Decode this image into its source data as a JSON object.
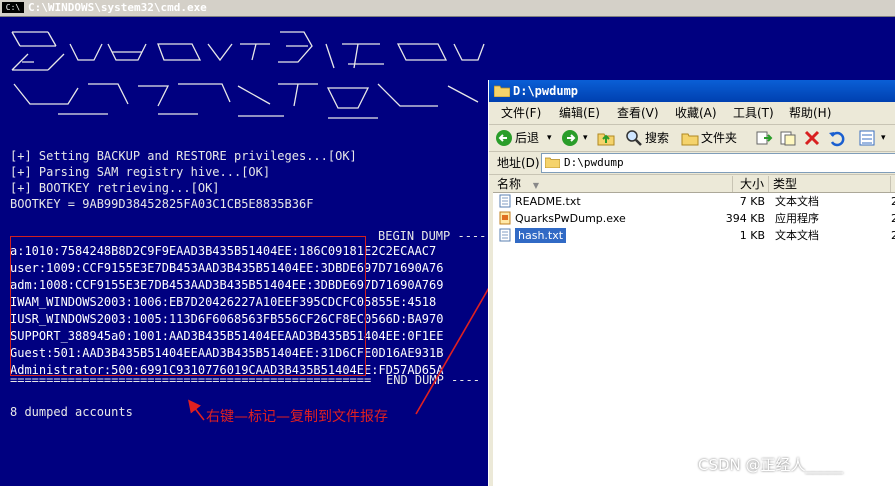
{
  "cmd": {
    "title": "C:\\WINDOWS\\system32\\cmd.exe",
    "title_icon": "C:\\",
    "status_lines": [
      "[+] Setting BACKUP and RESTORE privileges...[OK]",
      "[+] Parsing SAM registry hive...[OK]",
      "[+] BOOTKEY retrieving...[OK]",
      "BOOTKEY = 9AB99D38452825FA03C1CB5E8835B36F"
    ],
    "begin_dump": "BEGIN DUMP ----",
    "dump_lines": [
      "a:1010:7584248B8D2C9F9EAAD3B435B51404EE:186C09181E2C2ECAAC7",
      "user:1009:CCF9155E3E7DB453AAD3B435B51404EE:3DBDE697D71690A76",
      "adm:1008:CCF9155E3E7DB453AAD3B435B51404EE:3DBDE697D71690A769",
      "IWAM_WINDOWS2003:1006:EB7D20426227A10EEF395CDCFC05855E:4518",
      "IUSR_WINDOWS2003:1005:113D6F6068563FB556CF26CF8EC0566D:BA970",
      "SUPPORT_388945a0:1001:AAD3B435B51404EEAAD3B435B51404EE:0F1EE",
      "Guest:501:AAD3B435B51404EEAAD3B435B51404EE:31D6CFE0D16AE931B",
      "Administrator:500:6991C9310776019CAAD3B435B51404EE:FD57AD65A"
    ],
    "end_dump": "END DUMP ----",
    "summary": "8 dumped accounts",
    "annotation": "右键—标记—复制到文件报存",
    "annotation_color": "#e02020"
  },
  "explorer": {
    "title": "D:\\pwdump",
    "menu": [
      "文件(F)",
      "编辑(E)",
      "查看(V)",
      "收藏(A)",
      "工具(T)",
      "帮助(H)"
    ],
    "toolbar": {
      "back": "后退",
      "search": "搜索",
      "folders": "文件夹"
    },
    "address_label": "地址(D)",
    "address_value": "D:\\pwdump",
    "columns": [
      "名称",
      "大小",
      "类型"
    ],
    "files": [
      {
        "name": "README.txt",
        "size": "7 KB",
        "type": "文本文档",
        "icon": "text-file-icon",
        "selected": false
      },
      {
        "name": "QuarksPwDump.exe",
        "size": "394 KB",
        "type": "应用程序",
        "icon": "exe-file-icon",
        "selected": false
      },
      {
        "name": "hash.txt",
        "size": "1 KB",
        "type": "文本文档",
        "icon": "text-file-icon",
        "selected": true
      }
    ],
    "extra_column_glimpse": "2"
  },
  "watermark": "CSDN @正经人_____",
  "colors": {
    "console_bg": "#000080",
    "console_text": "#e8e8e8",
    "xp_title": "#0a5fd6",
    "xp_face": "#ece9d8"
  }
}
